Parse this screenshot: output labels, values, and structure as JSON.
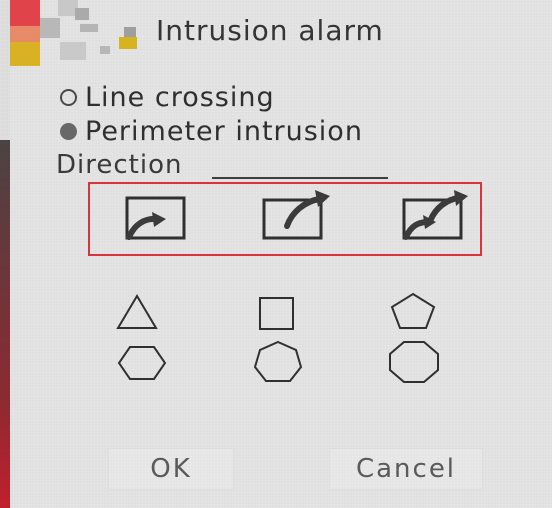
{
  "dialog": {
    "title": "Intrusion alarm",
    "options": [
      {
        "label": "Line crossing",
        "checked": false
      },
      {
        "label": "Perimeter intrusion",
        "checked": true
      }
    ],
    "direction_label": "Direction",
    "direction_buttons": [
      {
        "icon": "enter-area-arrow-icon"
      },
      {
        "icon": "exit-area-arrow-icon"
      },
      {
        "icon": "bidirectional-area-arrow-icon"
      }
    ],
    "shapes": [
      {
        "icon": "triangle-icon"
      },
      {
        "icon": "square-icon"
      },
      {
        "icon": "pentagon-icon"
      },
      {
        "icon": "hexagon-icon"
      },
      {
        "icon": "heptagon-icon"
      },
      {
        "icon": "octagon-icon"
      }
    ],
    "ok_label": "OK",
    "cancel_label": "Cancel"
  },
  "colors": {
    "selection_border": "#d9333d",
    "logo_red": "#e04349",
    "logo_yellow": "#d7b321",
    "logo_gray": "#a7a7a7"
  }
}
